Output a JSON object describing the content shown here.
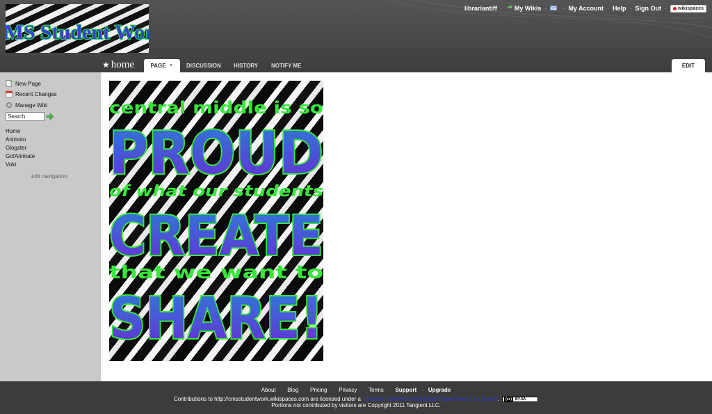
{
  "site": {
    "logo_text": "CMS Student Work"
  },
  "topnav": {
    "user": "librariantiff",
    "my_wikis": "My Wikis",
    "my_account": "My Account",
    "help": "Help",
    "sign_out": "Sign Out",
    "brand": "wikispaces"
  },
  "tabs": {
    "page_name": "home",
    "page": "PAGE",
    "discussion": "DISCUSSION",
    "history": "HISTORY",
    "notify": "NOTIFY ME",
    "edit": "EDIT"
  },
  "sidebar": {
    "new_page": "New Page",
    "recent_changes": "Recent Changes",
    "manage_wiki": "Manage Wiki",
    "search_value": "Search",
    "nav_items": [
      "Home",
      "Animoto",
      "Glogster",
      "Go!Animate",
      "Voki"
    ],
    "edit_navigation": "edit navigation"
  },
  "poster": {
    "line1": "central middle is so",
    "line2": "PROUD",
    "line3": "of what our students",
    "line4": "CREATE",
    "line5": "that we want to",
    "line6": "SHARE!"
  },
  "footer": {
    "links": [
      "About",
      "Blog",
      "Pricing",
      "Privacy",
      "Terms",
      "Support",
      "Upgrade"
    ],
    "license_prefix": "Contributions to http://cmsstudentwork.wikispaces.com are licensed under a",
    "license_link": "Creative Commons Attribution Share-Alike 3.0 License",
    "cc_badge": "BY-SA",
    "portions": "Portions not contributed by visitors are Copyright 2011 Tangient LLC."
  },
  "colors": {
    "poster_green": "#37e83a",
    "poster_blue": "#2a5fd6",
    "poster_purple": "#6a2ad6",
    "logo_text_color": "#3b3fd0",
    "logo_outline": "#2ee84a"
  }
}
